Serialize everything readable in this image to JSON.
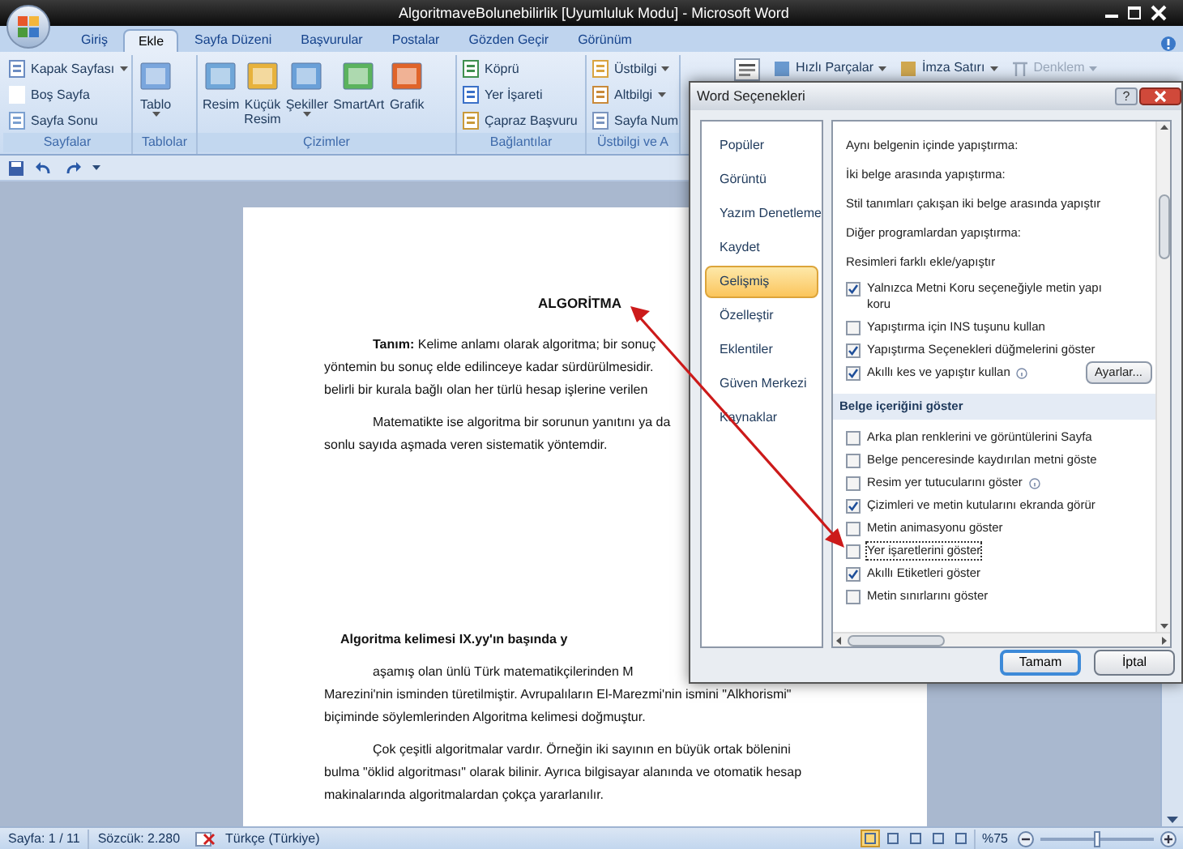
{
  "window": {
    "title": "AlgoritmaveBolunebilirlik [Uyumluluk Modu] - Microsoft Word"
  },
  "ribbon_tabs": [
    {
      "label": "Giriş",
      "selected": false
    },
    {
      "label": "Ekle",
      "selected": true
    },
    {
      "label": "Sayfa Düzeni",
      "selected": false
    },
    {
      "label": "Başvurular",
      "selected": false
    },
    {
      "label": "Postalar",
      "selected": false
    },
    {
      "label": "Gözden Geçir",
      "selected": false
    },
    {
      "label": "Görünüm",
      "selected": false
    }
  ],
  "ribbon_groups": [
    {
      "label": "Sayfalar",
      "items": [
        {
          "label": "Kapak Sayfası",
          "kind": "small",
          "dropdown": true
        },
        {
          "label": "Boş Sayfa",
          "kind": "small",
          "dropdown": false
        },
        {
          "label": "Sayfa Sonu",
          "kind": "small",
          "dropdown": false
        }
      ]
    },
    {
      "label": "Tablolar",
      "items": [
        {
          "label": "Tablo",
          "kind": "large",
          "dropdown": true
        }
      ]
    },
    {
      "label": "Çizimler",
      "items": [
        {
          "label": "Resim",
          "kind": "large",
          "dropdown": false
        },
        {
          "label": "Küçük Resim",
          "kind": "large",
          "dropdown": false
        },
        {
          "label": "Şekiller",
          "kind": "large",
          "dropdown": true
        },
        {
          "label": "SmartArt",
          "kind": "large",
          "dropdown": false
        },
        {
          "label": "Grafik",
          "kind": "large",
          "dropdown": false
        }
      ]
    },
    {
      "label": "Bağlantılar",
      "items": [
        {
          "label": "Köprü",
          "kind": "small",
          "dropdown": false
        },
        {
          "label": "Yer İşareti",
          "kind": "small",
          "dropdown": false
        },
        {
          "label": "Çapraz Başvuru",
          "kind": "small",
          "dropdown": false
        }
      ]
    },
    {
      "label": "Üstbilgi ve A",
      "items": [
        {
          "label": "Üstbilgi",
          "kind": "small",
          "dropdown": true
        },
        {
          "label": "Altbilgi",
          "kind": "small",
          "dropdown": true
        },
        {
          "label": "Sayfa Num",
          "kind": "small",
          "dropdown": false
        }
      ]
    }
  ],
  "ribbon_text_group": [
    {
      "label": "Hızlı Parçalar",
      "dropdown": true,
      "disabled": false
    },
    {
      "label": "İmza Satırı",
      "dropdown": true,
      "disabled": false
    },
    {
      "label": "Denklem",
      "dropdown": true,
      "disabled": true
    }
  ],
  "document": {
    "title": "ALGORİTMA",
    "lines": [
      {
        "kind": "indent",
        "text": "**Tanım:** Kelime anlamı olarak algoritma; bir sonuç"
      },
      {
        "kind": "plain",
        "text": "yöntemin bu sonuç elde edilinceye kadar sürdürülmesidir."
      },
      {
        "kind": "plain",
        "text": "belirli bir kurala bağlı olan her türlü  hesap işlerine verilen"
      },
      {
        "kind": "indent",
        "text": "Matematikte ise algoritma bir sorunun yanıtını ya da"
      },
      {
        "kind": "plain",
        "text": "sonlu sayıda aşmada veren sistematik yöntemdir."
      },
      {
        "kind": "heading",
        "text": "Algoritma kelimesi IX.yy'ın  başında y"
      },
      {
        "kind": "indent",
        "text": "aşamış  olan  ünlü  Türk  matematikçilerinden  M"
      },
      {
        "kind": "plain",
        "text": "Marezini'nin isminden türetilmiştir. Avrupalıların El-Marezmi'nin ismini \"Alkhorismi\""
      },
      {
        "kind": "plain",
        "text": "biçiminde söylemlerinden Algoritma kelimesi doğmuştur."
      },
      {
        "kind": "indent",
        "text": "Çok çeşitli algoritmalar vardır. Örneğin iki sayının en büyük ortak bölenini"
      },
      {
        "kind": "plain",
        "text": "bulma \"öklid algoritması\" olarak bilinir. Ayrıca bilgisayar alanında ve otomatik hesap"
      },
      {
        "kind": "plain",
        "text": "makinalarında algoritmalardan çokça yararlanılır."
      }
    ]
  },
  "dialog": {
    "title": "Word Seçenekleri",
    "help": "?",
    "nav": [
      {
        "label": "Popüler",
        "selected": false
      },
      {
        "label": "Görüntü",
        "selected": false
      },
      {
        "label": "Yazım Denetleme",
        "selected": false
      },
      {
        "label": "Kaydet",
        "selected": false
      },
      {
        "label": "Gelişmiş",
        "selected": true
      },
      {
        "label": "Özelleştir",
        "selected": false
      },
      {
        "label": "Eklentiler",
        "selected": false
      },
      {
        "label": "Güven Merkezi",
        "selected": false
      },
      {
        "label": "Kaynaklar",
        "selected": false
      }
    ],
    "options": [
      {
        "kind": "label",
        "text": "Aynı belgenin içinde yapıştırma:"
      },
      {
        "kind": "label",
        "text": "İki belge arasında yapıştırma:"
      },
      {
        "kind": "label",
        "text": "Stil tanımları çakışan iki belge arasında yapıştır"
      },
      {
        "kind": "label",
        "text": "Diğer programlardan yapıştırma:"
      },
      {
        "kind": "label",
        "text": "Resimleri farklı ekle/yapıştır"
      },
      {
        "kind": "check",
        "text": "Yalnızca Metni Koru seçeneğiyle metin yapı koru",
        "checked": true,
        "info": false,
        "focused": false
      },
      {
        "kind": "check",
        "text": "Yapıştırma için INS tuşunu kullan",
        "checked": false,
        "info": false,
        "focused": false
      },
      {
        "kind": "check",
        "text": "Yapıştırma Seçenekleri düğmelerini göster",
        "checked": true,
        "info": false,
        "focused": false
      },
      {
        "kind": "check",
        "text": "Akıllı kes ve yapıştır kullan",
        "checked": true,
        "info": true,
        "focused": false,
        "button": "Ayarlar..."
      },
      {
        "kind": "section",
        "text": "Belge içeriğini göster"
      },
      {
        "kind": "check",
        "text": "Arka plan renklerini ve görüntülerini Sayfa",
        "checked": false,
        "info": false,
        "focused": false
      },
      {
        "kind": "check",
        "text": "Belge penceresinde kaydırılan metni göste",
        "checked": false,
        "info": false,
        "focused": false
      },
      {
        "kind": "check",
        "text": "Resim yer tutucularını göster",
        "checked": false,
        "info": true,
        "focused": false
      },
      {
        "kind": "check",
        "text": "Çizimleri ve metin kutularını ekranda görür",
        "checked": true,
        "info": false,
        "focused": false
      },
      {
        "kind": "check",
        "text": "Metin animasyonu göster",
        "checked": false,
        "info": false,
        "focused": false
      },
      {
        "kind": "check",
        "text": "Yer işaretlerini göster",
        "checked": false,
        "info": false,
        "focused": true
      },
      {
        "kind": "check",
        "text": "Akıllı Etiketleri göster",
        "checked": true,
        "info": false,
        "focused": false
      },
      {
        "kind": "check",
        "text": "Metin sınırlarını göster",
        "checked": false,
        "info": false,
        "focused": false
      }
    ],
    "buttons": [
      {
        "label": "Tamam",
        "default": true
      },
      {
        "label": "İptal",
        "default": false
      }
    ]
  },
  "status_bar": {
    "page": "Sayfa: 1 / 11",
    "words": "Sözcük: 2.280",
    "language": "Türkçe (Türkiye)",
    "zoom": "%75",
    "views": [
      {
        "selected": true
      },
      {
        "selected": false
      },
      {
        "selected": false
      },
      {
        "selected": false
      },
      {
        "selected": false
      }
    ],
    "zoom_slider": {
      "level": 0.5
    }
  }
}
